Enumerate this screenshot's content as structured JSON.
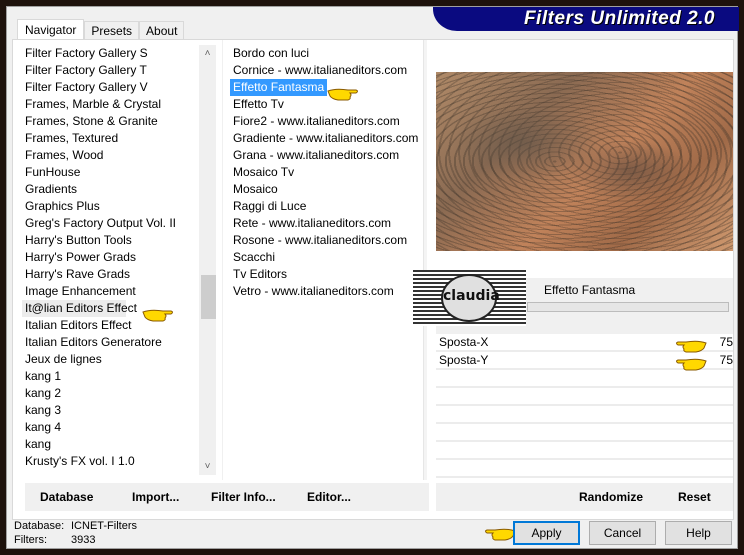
{
  "app": {
    "title": "Filters Unlimited 2.0"
  },
  "tabs": [
    {
      "label": "Navigator",
      "active": true
    },
    {
      "label": "Presets",
      "active": false
    },
    {
      "label": "About",
      "active": false
    }
  ],
  "categories": {
    "items": [
      "Filter Factory Gallery S",
      "Filter Factory Gallery T",
      "Filter Factory Gallery V",
      "Frames, Marble & Crystal",
      "Frames, Stone & Granite",
      "Frames, Textured",
      "Frames, Wood",
      "FunHouse",
      "Gradients",
      "Graphics Plus",
      "Greg's Factory Output Vol. II",
      "Harry's Button Tools",
      "Harry's Power Grads",
      "Harry's Rave Grads",
      "Image Enhancement",
      "It@lian Editors Effect",
      "Italian Editors Effect",
      "Italian Editors Generatore",
      "Jeux de lignes",
      "kang 1",
      "kang 2",
      "kang 3",
      "kang 4",
      "kang",
      "Krusty's FX vol. I 1.0"
    ],
    "highlighted": "It@lian Editors Effect"
  },
  "filters": {
    "items": [
      "Bordo con luci",
      "Cornice - www.italianeditors.com",
      "Effetto Fantasma",
      "Effetto Tv",
      "Fiore2 - www.italianeditors.com",
      "Gradiente - www.italianeditors.com",
      "Grana - www.italianeditors.com",
      "Mosaico Tv",
      "Mosaico",
      "Raggi di Luce",
      "Rete - www.italianeditors.com",
      "Rosone - www.italianeditors.com",
      "Scacchi",
      "Tv Editors",
      "Vetro - www.italianeditors.com"
    ],
    "selected": "Effetto Fantasma"
  },
  "filter_panel": {
    "name": "Effetto Fantasma",
    "logo_text": "claudia",
    "params": [
      {
        "label": "Sposta-X",
        "value": "75"
      },
      {
        "label": "Sposta-Y",
        "value": "75"
      }
    ]
  },
  "toolbar_left": {
    "database": "Database",
    "import": "Import...",
    "filter_info": "Filter Info...",
    "editor": "Editor..."
  },
  "toolbar_right": {
    "randomize": "Randomize",
    "reset": "Reset"
  },
  "status": {
    "database_label": "Database:",
    "database_value": "ICNET-Filters",
    "filters_label": "Filters:",
    "filters_value": "3933"
  },
  "buttons": {
    "apply": "Apply",
    "cancel": "Cancel",
    "help": "Help"
  },
  "colors": {
    "brand_bg": "#0a0a80",
    "selection": "#3399ff",
    "default_button_border": "#0078d7"
  }
}
